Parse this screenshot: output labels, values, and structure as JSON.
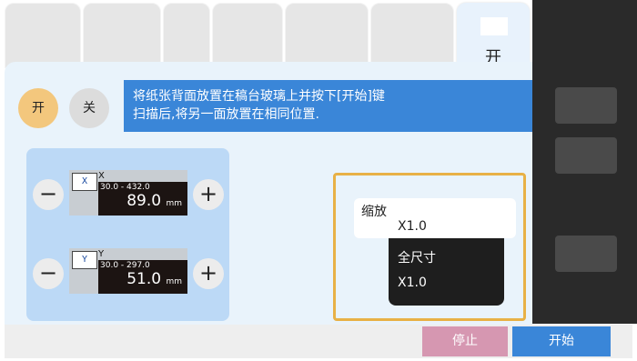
{
  "top_tabs": {
    "active_label": "开"
  },
  "mode": {
    "on_label": "开",
    "off_label": "关"
  },
  "banner": {
    "line1": "将纸张背面放置在稿台玻璃上并按下[开始]键",
    "line2": "扫描后,将另一面放置在相同位置."
  },
  "x_field": {
    "icon_text": "X",
    "axis": "X",
    "range": "30.0 - 432.0",
    "value": "89.0",
    "unit": "mm",
    "minus": "−",
    "plus": "+"
  },
  "y_field": {
    "icon_text": "Y",
    "axis": "Y",
    "range": "30.0 - 297.0",
    "value": "51.0",
    "unit": "mm",
    "minus": "−",
    "plus": "+"
  },
  "zoom": {
    "label": "缩放",
    "current": "X1.0",
    "options": [
      "全尺寸",
      "X1.0"
    ]
  },
  "bottom": {
    "stop_label": "停止",
    "start_label": "开始"
  },
  "colors": {
    "accent_blue": "#3a86d8",
    "zoom_border": "#e8b146",
    "stop_pink": "#d697b1",
    "on_circle": "#f3c77d"
  }
}
